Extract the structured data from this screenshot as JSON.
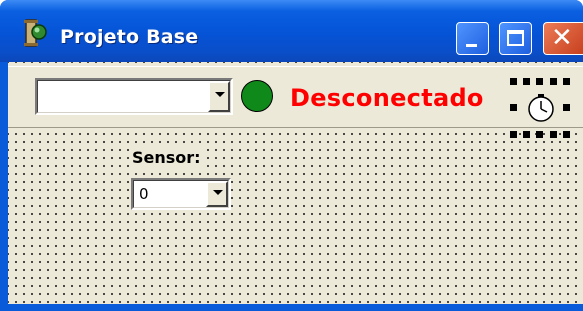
{
  "window": {
    "title": "Projeto Base",
    "controls": {
      "minimize": "minimize-button",
      "maximize": "maximize-button",
      "close": "close-button",
      "close_glyph": "✕"
    }
  },
  "toolbar": {
    "port_select": {
      "value": ""
    },
    "status": {
      "text": "Desconectado",
      "led_color": "#0f8a1a",
      "text_color": "#ff0000"
    },
    "timer_icon": "clock-icon"
  },
  "form": {
    "sensor_label": "Sensor:",
    "sensor_select": {
      "value": "0"
    }
  },
  "colors": {
    "titlebar": "#0553d6",
    "client_bg": "#ece9d8",
    "close_button": "#c8401e"
  }
}
